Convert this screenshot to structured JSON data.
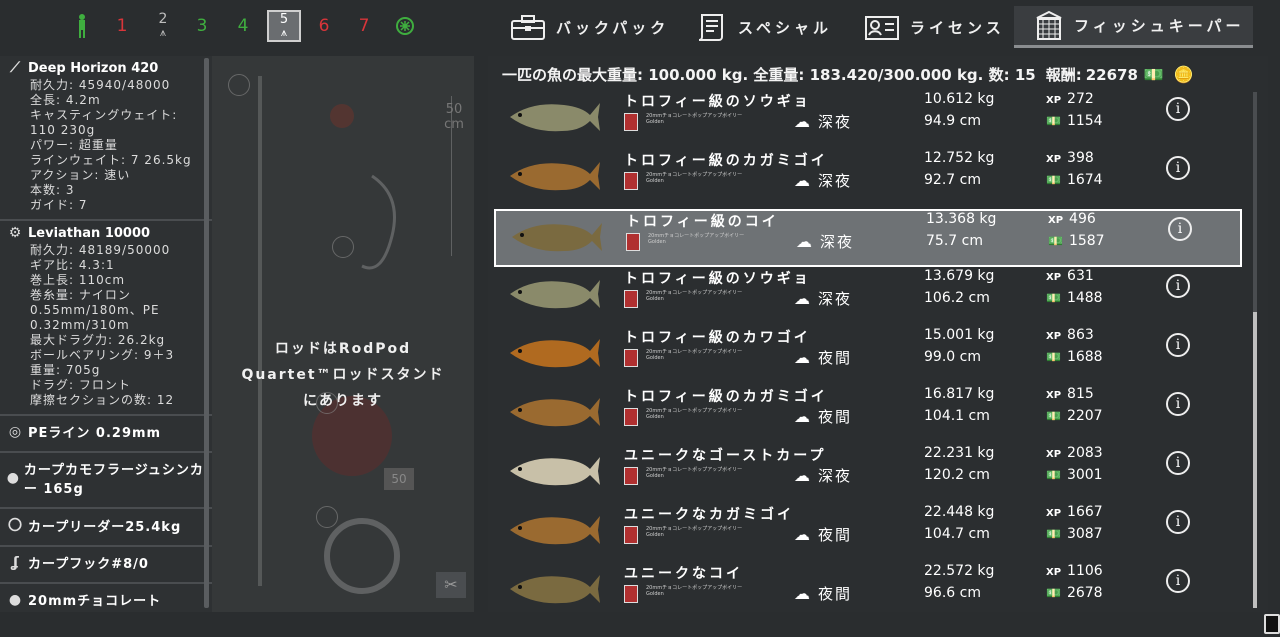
{
  "slots": [
    "1",
    "2",
    "3",
    "4",
    "5",
    "6",
    "7"
  ],
  "tabs": [
    {
      "label": "バックパック",
      "icon": "toolbox-icon"
    },
    {
      "label": "スペシャル",
      "icon": "scroll-icon"
    },
    {
      "label": "ライセンス",
      "icon": "license-icon"
    },
    {
      "label": "フィッシュキーパー",
      "icon": "fish-keeper-icon"
    }
  ],
  "rod": {
    "name": "Deep Horizon 420",
    "stats": [
      "耐久力: 45940/48000",
      "全長: 4.2m",
      "キャスティングウェイト: 110 230g",
      "パワー: 超重量",
      "ラインウェイト: 7 26.5kg",
      "アクション: 速い",
      "本数: 3",
      "ガイド: 7"
    ]
  },
  "reel": {
    "name": "Leviathan 10000",
    "stats": [
      "耐久力: 48189/50000",
      "ギア比: 4.3:1",
      "巻上長: 110cm",
      "巻糸量: ナイロン 0.55mm/180m、PE 0.32mm/310m",
      "最大ドラグ力: 26.2kg",
      "ボールベアリング: 9＋3",
      "重量: 705g",
      "ドラグ: フロント",
      "摩擦セクションの数: 12"
    ]
  },
  "tackle": [
    {
      "label": "PEライン 0.29mm",
      "icon": "line-spool-icon"
    },
    {
      "label": "カープカモフラージュシンカー 165g",
      "icon": "sinker-icon"
    },
    {
      "label": "カープリーダー25.4kg",
      "icon": "leader-icon"
    },
    {
      "label": "カープフック#8/0",
      "icon": "hook-icon"
    },
    {
      "label": "20mmチョコレート",
      "icon": "bait-icon"
    }
  ],
  "mid": {
    "message": "ロッドはRodPod Quartet™ロッドスタンドにあります",
    "hook_size": "50",
    "hook_unit": "cm",
    "spool_badge": "50"
  },
  "header": {
    "text": "一匹の魚の最大重量: 100.000 kg. 全重量: 183.420/300.000 kg. 数: 15",
    "reward_label": "報酬:",
    "reward": "22678"
  },
  "fish": [
    {
      "name": "トロフィー級のソウギョ",
      "bait": "20mmチョコレートポップアップボイリー",
      "bait2": "Golden",
      "tod": "深夜",
      "weight": "10.612 kg",
      "length": "94.9 cm",
      "xp": "272",
      "money": "1154",
      "color": "#8a8a6a"
    },
    {
      "name": "トロフィー級のカガミゴイ",
      "bait": "20mmチョコレートポップアップボイリー",
      "bait2": "Golden",
      "tod": "深夜",
      "weight": "12.752 kg",
      "length": "92.7 cm",
      "xp": "398",
      "money": "1674",
      "color": "#9a6a30"
    },
    {
      "name": "トロフィー級のコイ",
      "bait": "20mmチョコレートポップアップボイリー",
      "bait2": "Golden",
      "tod": "深夜",
      "weight": "13.368 kg",
      "length": "75.7 cm",
      "xp": "496",
      "money": "1587",
      "color": "#7a6a40",
      "selected": true
    },
    {
      "name": "トロフィー級のソウギョ",
      "bait": "20mmチョコレートポップアップボイリー",
      "bait2": "Golden",
      "tod": "深夜",
      "weight": "13.679 kg",
      "length": "106.2 cm",
      "xp": "631",
      "money": "1488",
      "color": "#8a8a6a"
    },
    {
      "name": "トロフィー級のカワゴイ",
      "bait": "20mmチョコレートポップアップボイリー",
      "bait2": "Golden",
      "tod": "夜間",
      "weight": "15.001 kg",
      "length": "99.0 cm",
      "xp": "863",
      "money": "1688",
      "color": "#b06a20"
    },
    {
      "name": "トロフィー級のカガミゴイ",
      "bait": "20mmチョコレートポップアップボイリー",
      "bait2": "Golden",
      "tod": "夜間",
      "weight": "16.817 kg",
      "length": "104.1 cm",
      "xp": "815",
      "money": "2207",
      "color": "#9a6a30"
    },
    {
      "name": "ユニークなゴーストカープ",
      "bait": "20mmチョコレートポップアップボイリー",
      "bait2": "Golden",
      "tod": "深夜",
      "weight": "22.231 kg",
      "length": "120.2 cm",
      "xp": "2083",
      "money": "3001",
      "color": "#c8c0a8"
    },
    {
      "name": "ユニークなカガミゴイ",
      "bait": "20mmチョコレートポップアップボイリー",
      "bait2": "Golden",
      "tod": "夜間",
      "weight": "22.448 kg",
      "length": "104.7 cm",
      "xp": "1667",
      "money": "3087",
      "color": "#9a6a30"
    },
    {
      "name": "ユニークなコイ",
      "bait": "20mmチョコレートポップアップボイリー",
      "bait2": "Golden",
      "tod": "夜間",
      "weight": "22.572 kg",
      "length": "96.6 cm",
      "xp": "1106",
      "money": "2678",
      "color": "#7a6a40"
    }
  ]
}
